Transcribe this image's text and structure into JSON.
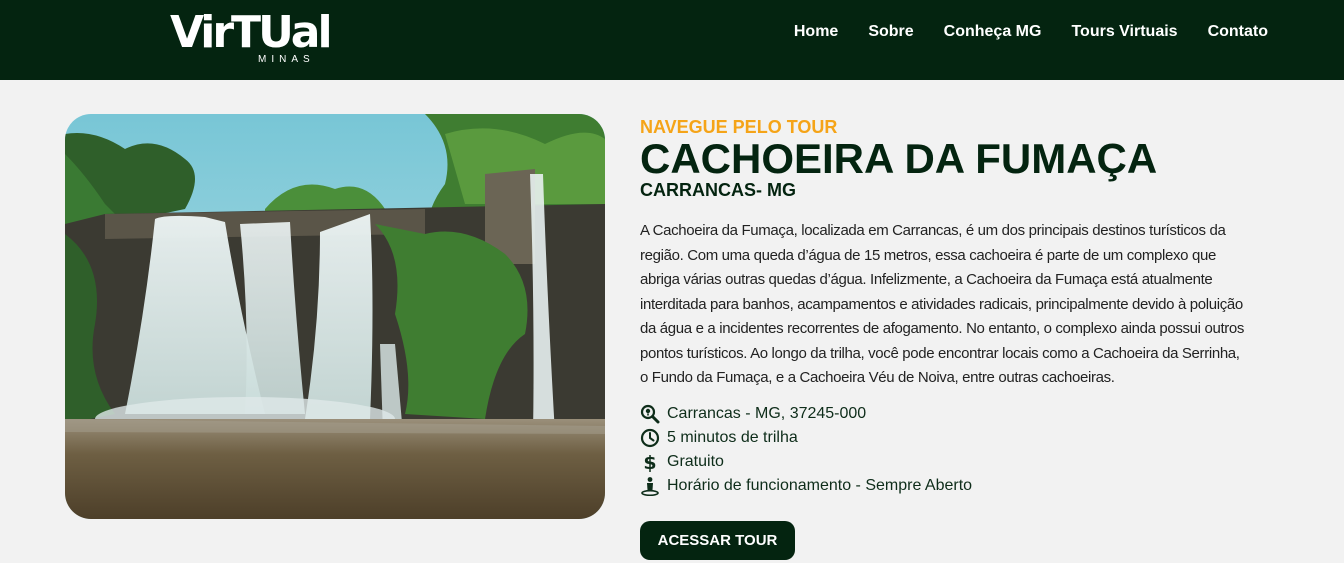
{
  "brand": {
    "logo_text": "VirTUal",
    "logo_sub": "MINAS"
  },
  "nav": {
    "items": [
      "Home",
      "Sobre",
      "Conheça MG",
      "Tours Virtuais",
      "Contato"
    ]
  },
  "hero": {
    "image_alt": "Cachoeira da Fumaça waterfall",
    "eyebrow": "NAVEGUE PELO TOUR",
    "title": "CACHOEIRA DA FUMAÇA",
    "subtitle": "CARRANCAS- MG",
    "description": "A Cachoeira da Fumaça, localizada em Carrancas, é um dos principais destinos turísticos da região. Com uma queda d’água de 15 metros, essa cachoeira é parte de um complexo que abriga várias outras quedas d’água. Infelizmente, a Cachoeira da Fumaça está atualmente interditada para banhos, acampamentos e atividades radicais, principalmente devido à poluição da água e a incidentes recorrentes de afogamento. No entanto, o complexo ainda possui outros pontos turísticos. Ao longo da trilha, você pode encontrar locais como a Cachoeira da Serrinha, o Fundo da Fumaça, e a Cachoeira Véu de Noiva, entre outras cachoeiras."
  },
  "info": [
    {
      "icon": "location-search-icon",
      "text": "Carrancas - MG, 37245-000"
    },
    {
      "icon": "clock-icon",
      "text": "5 minutos de trilha"
    },
    {
      "icon": "dollar-icon",
      "text": "Gratuito"
    },
    {
      "icon": "person-pin-icon",
      "text": "Horário de funcionamento - Sempre Aberto"
    }
  ],
  "cta": {
    "label": "ACESSAR TOUR"
  },
  "colors": {
    "header_bg": "#042410",
    "accent": "#f5a418",
    "text_dark": "#042410",
    "page_bg": "#f2f2f2"
  }
}
